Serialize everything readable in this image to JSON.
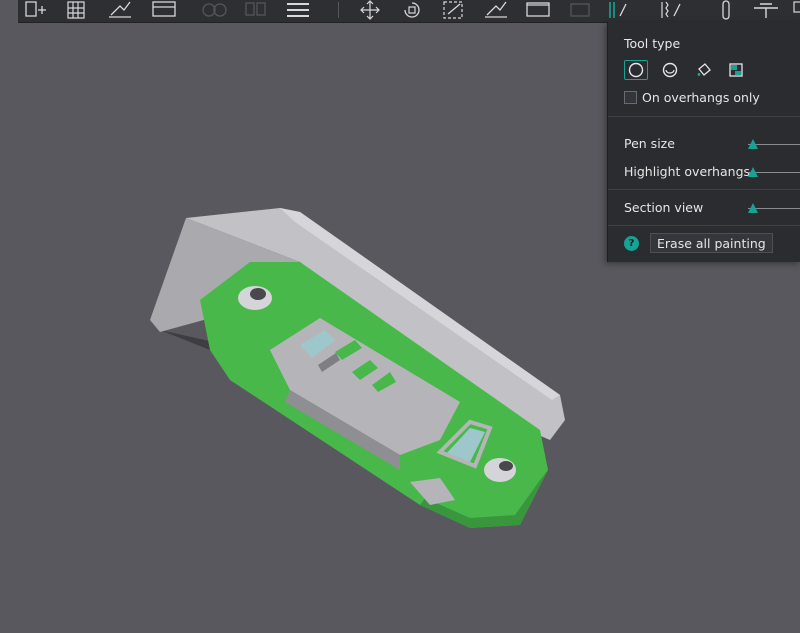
{
  "toolbar": {
    "icons": [
      "add-plate-icon",
      "arrange-grid-icon",
      "auto-orient-icon",
      "split-objects-icon",
      "disabled-a-icon",
      "disabled-b-icon",
      "layers-icon",
      "move-icon",
      "rotate-icon",
      "scale-icon",
      "lay-on-face-icon",
      "cut-icon",
      "disabled-c-icon",
      "support-paint-icon",
      "seam-paint-icon",
      "fuzzy-skin-paint-icon",
      "brush-icon",
      "measure-icon",
      "text-tool-icon"
    ]
  },
  "panel": {
    "tool_type_label": "Tool type",
    "tools": [
      "circle-tool-icon",
      "sphere-tool-icon",
      "fill-tool-icon",
      "gap-fill-tool-icon"
    ],
    "overhangs_only_label": "On overhangs only",
    "pen_size_label": "Pen size",
    "highlight_overhangs_label": "Highlight overhangs",
    "section_view_label": "Section view",
    "erase_label": "Erase all painting",
    "help_glyph": "?"
  },
  "colors": {
    "accent": "#16a394",
    "part_gray": "#b9b9bd",
    "painted_green": "#49b84b",
    "window_blue": "#9ec7cc",
    "background": "#58585e"
  }
}
